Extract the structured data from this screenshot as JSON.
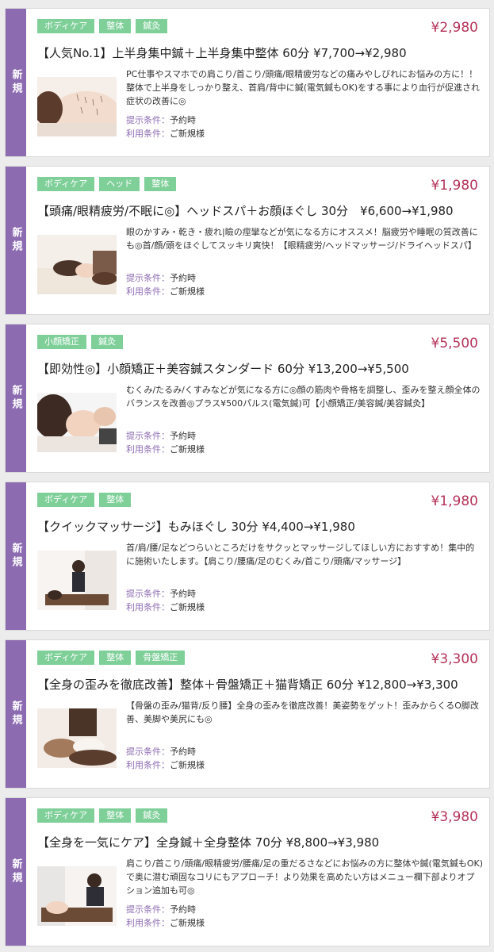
{
  "badge_text": "新規",
  "condition_labels": {
    "present": "提示条件：",
    "use": "利用条件："
  },
  "coupons": [
    {
      "tags": [
        "ボディケア",
        "整体",
        "鍼灸"
      ],
      "price": "¥2,980",
      "title": "【人気No.1】上半身集中鍼＋上半身集中整体 60分 ¥7,700→¥2,980",
      "description": "PC仕事やスマホでの肩こり/首こり/頭痛/眼精疲労などの痛みやしびれにお悩みの方に！！整体で上半身をしっかり整え、首肩/背中に鍼(電気鍼もOK)をする事により血行が促進され症状の改善に◎",
      "present_condition": "予約時",
      "use_condition": "ご新規様",
      "photo_icon": "acupuncture-back-photo"
    },
    {
      "tags": [
        "ボディケア",
        "ヘッド",
        "整体"
      ],
      "price": "¥1,980",
      "title": "【頭痛/眼精疲労/不眠に◎】ヘッドスパ＋お顔ほぐし 30分　¥6,600→¥1,980",
      "description": "眼のかすみ・乾き・疲れ|瞼の痙攣などが気になる方にオススメ！脳疲労や睡眠の質改善にも◎首/顔/頭をほぐしてスッキリ爽快！【眼精疲労/ヘッドマッサージ/ドライヘッドスパ】",
      "present_condition": "予約時",
      "use_condition": "ご新規様",
      "photo_icon": "head-spa-photo"
    },
    {
      "tags": [
        "小顔矯正",
        "鍼灸"
      ],
      "price": "¥5,500",
      "title": "【即効性◎】小顔矯正＋美容鍼スタンダード 60分 ¥13,200→¥5,500",
      "description": "むくみ/たるみ/くすみなどが気になる方に◎顔の筋肉や骨格を調整し、歪みを整え顔全体のバランスを改善◎プラス¥500パルス(電気鍼)可【小顔矯正/美容鍼/美容鍼灸】",
      "present_condition": "予約時",
      "use_condition": "ご新規様",
      "photo_icon": "facial-correction-photo"
    },
    {
      "tags": [
        "ボディケア",
        "整体"
      ],
      "price": "¥1,980",
      "title": "【クイックマッサージ】もみほぐし 30分 ¥4,400→¥1,980",
      "description": "首/肩/腰/足などつらいところだけをサクッとマッサージしてほしい方におすすめ！集中的に施術いたします。【肩こり/腰痛/足のむくみ/首こり/頭痛/マッサージ】",
      "present_condition": "予約時",
      "use_condition": "ご新規様",
      "photo_icon": "massage-photo"
    },
    {
      "tags": [
        "ボディケア",
        "整体",
        "骨盤矯正"
      ],
      "price": "¥3,300",
      "title": "【全身の歪みを徹底改善】整体＋骨盤矯正＋猫背矯正 60分 ¥12,800→¥3,300",
      "description": "【骨盤の歪み/猫背/反り腰】全身の歪みを徹底改善！美姿勢をゲット！歪みからくるO脚改善、美脚や美尻にも◎",
      "present_condition": "予約時",
      "use_condition": "ご新規様",
      "photo_icon": "pelvis-correction-photo"
    },
    {
      "tags": [
        "ボディケア",
        "整体",
        "鍼灸"
      ],
      "price": "¥3,980",
      "title": "【全身を一気にケア】全身鍼＋全身整体 70分 ¥8,800→¥3,980",
      "description": "肩こり/首こり/頭痛/眼精疲労/腰痛/足の重だるさなどにお悩みの方に整体や鍼(電気鍼もOK)で奥に潜む頑固なコリにもアプローチ！より効果を高めたい方はメニュー欄下部よりオプション追加も可◎",
      "present_condition": "予約時",
      "use_condition": "ご新規様",
      "photo_icon": "full-body-treatment-photo"
    }
  ]
}
